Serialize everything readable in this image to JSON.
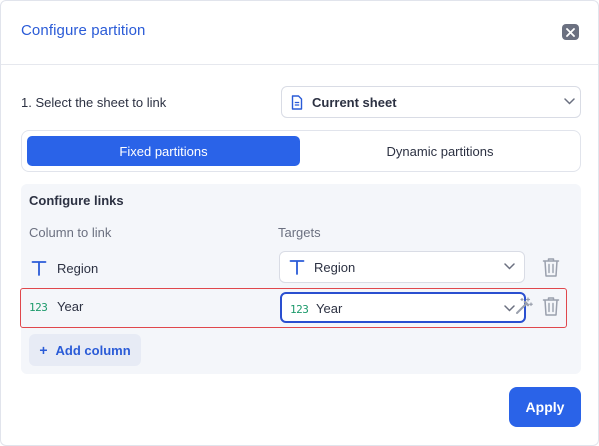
{
  "dialog": {
    "title": "Configure partition",
    "close_icon": "close-icon"
  },
  "sheet": {
    "label": "1. Select the sheet to link",
    "value": "Current sheet",
    "icon": "document-icon"
  },
  "partition_tabs": [
    {
      "label": "Fixed partitions",
      "active": true
    },
    {
      "label": "Dynamic partitions",
      "active": false
    }
  ],
  "links": {
    "title": "Configure links",
    "column_header": "Column to link",
    "targets_header": "Targets",
    "rows": [
      {
        "column": "Region",
        "column_icon": "text-type-icon",
        "target": "Region",
        "target_icon": "text-type-icon",
        "highlighted": false
      },
      {
        "column": "Year",
        "column_icon": "number-type-icon",
        "target": "Year",
        "target_icon": "number-type-icon",
        "highlighted": true
      }
    ],
    "number_icon_text": "123",
    "add_label": "Add column"
  },
  "footer": {
    "apply_label": "Apply"
  },
  "colors": {
    "accent": "#2a63e8",
    "highlight_border": "#e0474c",
    "number_icon": "#1c9a6b"
  }
}
